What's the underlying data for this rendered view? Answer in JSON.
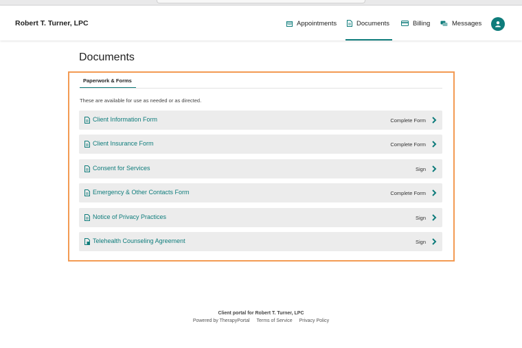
{
  "header": {
    "brand": "Robert T. Turner, LPC",
    "nav": [
      {
        "label": "Appointments",
        "icon": "calendar-icon"
      },
      {
        "label": "Documents",
        "icon": "document-icon",
        "active": true
      },
      {
        "label": "Billing",
        "icon": "credit-card-icon"
      },
      {
        "label": "Messages",
        "icon": "chat-icon"
      }
    ],
    "avatar_icon": "user-icon"
  },
  "page": {
    "title": "Documents",
    "tab": "Paperwork & Forms",
    "intro": "These are available for use as needed or as directed."
  },
  "documents": [
    {
      "name": "Client Information Form",
      "action": "Complete Form"
    },
    {
      "name": "Client Insurance Form",
      "action": "Complete Form"
    },
    {
      "name": "Consent for Services",
      "action": "Sign"
    },
    {
      "name": "Emergency & Other Contacts Form",
      "action": "Complete Form"
    },
    {
      "name": "Notice of Privacy Practices",
      "action": "Sign"
    },
    {
      "name": "Telehealth Counseling Agreement",
      "action": "Sign"
    }
  ],
  "footer": {
    "line1": "Client portal for Robert T. Turner, LPC",
    "powered": "Powered by TherapyPortal",
    "terms": "Terms of Service",
    "privacy": "Privacy Policy"
  },
  "colors": {
    "accent": "#0e7c7b",
    "highlight_border": "#f39a52",
    "row_bg": "#ececec"
  }
}
